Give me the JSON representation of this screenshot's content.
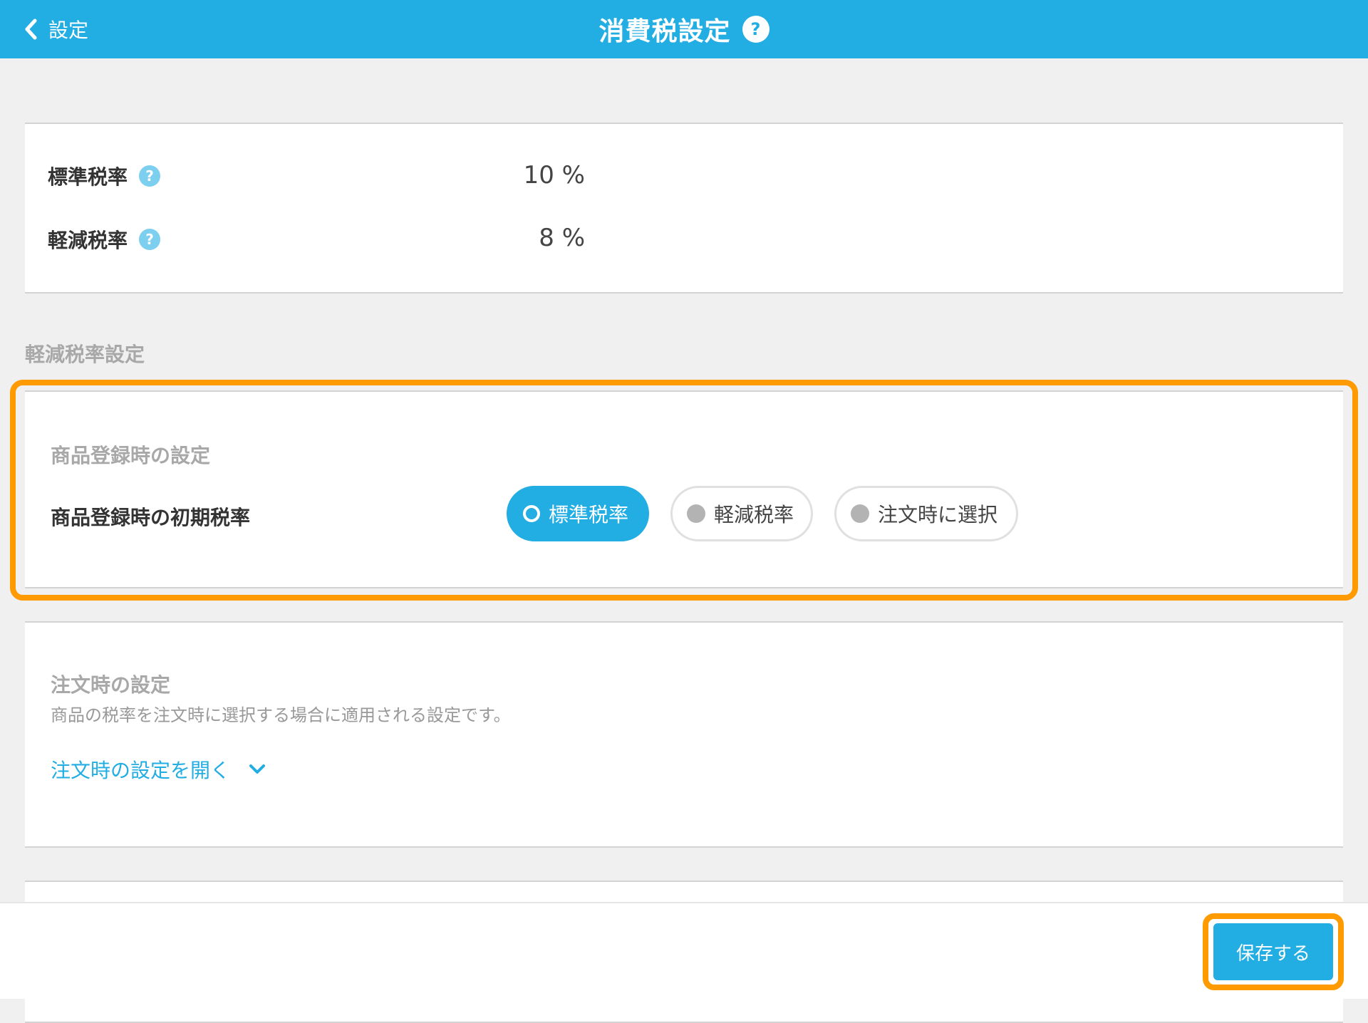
{
  "header": {
    "back_label": "設定",
    "title": "消費税設定",
    "help_glyph": "?"
  },
  "rates": {
    "standard": {
      "label": "標準税率",
      "help_glyph": "?",
      "value": "10 %"
    },
    "reduced": {
      "label": "軽減税率",
      "help_glyph": "?",
      "value": "8 %"
    }
  },
  "reduced_settings": {
    "section_label": "軽減税率設定",
    "product_registration": {
      "sub_label": "商品登録時の設定",
      "label": "商品登録時の初期税率",
      "options": [
        "標準税率",
        "軽減税率",
        "注文時に選択"
      ],
      "selected": "標準税率"
    }
  },
  "order_settings": {
    "title": "注文時の設定",
    "description": "商品の税率を注文時に選択する場合に適用される設定です。",
    "expand_label": "注文時の設定を開く"
  },
  "footer": {
    "save_label": "保存する"
  },
  "colors": {
    "brand": "#22ade3",
    "highlight": "#ff9a00",
    "help_icon": "#7ccfef",
    "muted_text": "#a8a8a8",
    "background": "#f0f0f0"
  },
  "icons": {
    "back": "chevron-left-icon",
    "help": "question-circle-icon",
    "expand": "chevron-down-icon",
    "radio_selected": "ring-icon",
    "radio_unselected": "dot-icon"
  }
}
